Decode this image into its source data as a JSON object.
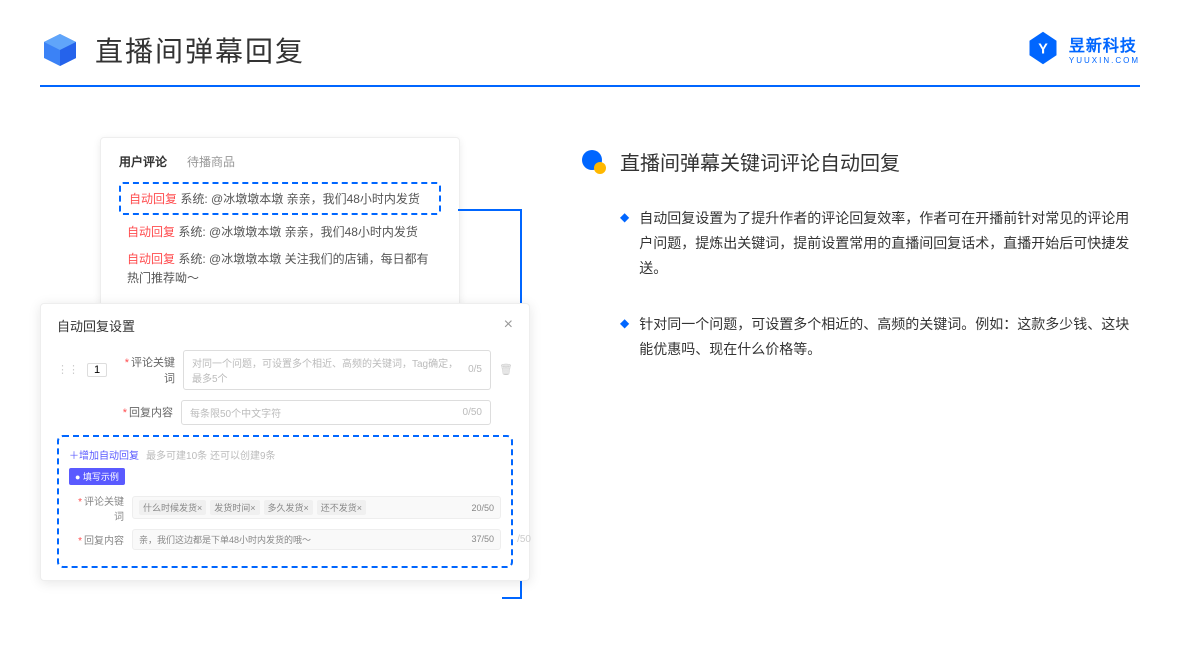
{
  "header": {
    "title": "直播间弹幕回复"
  },
  "logo": {
    "name": "昱新科技",
    "subtitle": "YUUXIN.COM"
  },
  "comment_card": {
    "tab_active": "用户评论",
    "tab_inactive": "待播商品",
    "auto_label": "自动回复",
    "sys_prefix": "系统:",
    "highlighted": "@冰墩墩本墩 亲亲，我们48小时内发货",
    "line2": "@冰墩墩本墩 亲亲，我们48小时内发货",
    "line3": "@冰墩墩本墩 关注我们的店铺，每日都有热门推荐呦～"
  },
  "settings": {
    "title": "自动回复设置",
    "num": "1",
    "kw_label": "评论关键词",
    "kw_placeholder": "对同一个问题，可设置多个相近、高频的关键词，Tag确定，最多5个",
    "kw_count": "0/5",
    "content_label": "回复内容",
    "content_placeholder": "每条限50个中文字符",
    "content_count": "0/50",
    "add_link": "＋增加自动回复",
    "add_hint": "最多可建10条 还可以创建9条",
    "example_badge": "● 填写示例",
    "ex_kw_label": "评论关键词",
    "ex_tags": [
      "什么时候发货×",
      "发货时间×",
      "多久发货×",
      "还不发货×"
    ],
    "ex_kw_count": "20/50",
    "ex_content_label": "回复内容",
    "ex_content_value": "亲，我们这边都是下单48小时内发货的哦～",
    "ex_content_count": "37/50",
    "outer_count": "/50"
  },
  "right": {
    "feature_title": "直播间弹幕关键词评论自动回复",
    "bullet1": "自动回复设置为了提升作者的评论回复效率，作者可在开播前针对常见的评论用户问题，提炼出关键词，提前设置常用的直播间回复话术，直播开始后可快捷发送。",
    "bullet2": "针对同一个问题，可设置多个相近的、高频的关键词。例如：这款多少钱、这块能优惠吗、现在什么价格等。"
  }
}
